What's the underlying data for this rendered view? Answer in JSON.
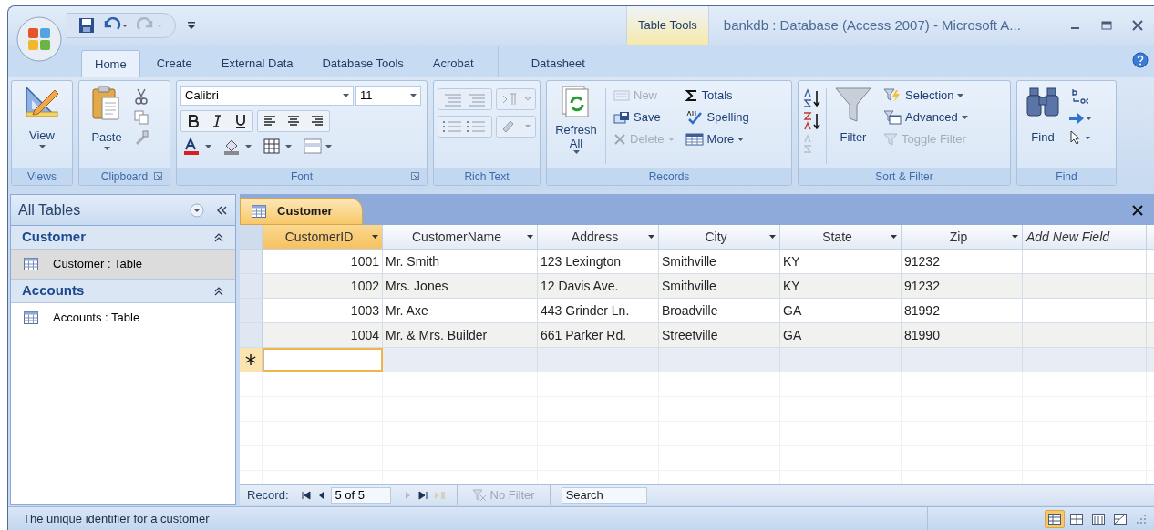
{
  "window": {
    "title": "bankdb : Database (Access 2007) - Microsoft A...",
    "context_group": "Table Tools"
  },
  "ribbon_tabs": [
    {
      "label": "Home",
      "selected": true
    },
    {
      "label": "Create",
      "selected": false
    },
    {
      "label": "External Data",
      "selected": false
    },
    {
      "label": "Database Tools",
      "selected": false
    },
    {
      "label": "Acrobat",
      "selected": false
    }
  ],
  "context_tabs": [
    {
      "label": "Datasheet",
      "selected": false
    }
  ],
  "ribbon": {
    "views": {
      "label": "Views",
      "view_button": "View"
    },
    "clipboard": {
      "label": "Clipboard",
      "paste_button": "Paste"
    },
    "font": {
      "label": "Font",
      "font_name": "Calibri",
      "font_size": "11"
    },
    "rich_text": {
      "label": "Rich Text"
    },
    "records": {
      "label": "Records",
      "refresh_button": "Refresh All",
      "buttons": [
        {
          "label": "New",
          "disabled": true
        },
        {
          "label": "Save",
          "disabled": false
        },
        {
          "label": "Delete",
          "disabled": true
        },
        {
          "label": "Totals",
          "disabled": false
        },
        {
          "label": "Spelling",
          "disabled": false
        },
        {
          "label": "More",
          "disabled": false
        }
      ]
    },
    "sort_filter": {
      "label": "Sort & Filter",
      "filter_button": "Filter",
      "buttons": [
        {
          "label": "Selection",
          "disabled": false
        },
        {
          "label": "Advanced",
          "disabled": false
        },
        {
          "label": "Toggle Filter",
          "disabled": true
        }
      ]
    },
    "find": {
      "label": "Find",
      "find_button": "Find"
    }
  },
  "nav_pane": {
    "title": "All Tables",
    "groups": [
      {
        "label": "Customer",
        "expanded": true,
        "items": [
          {
            "label": "Customer : Table",
            "selected": true
          }
        ]
      },
      {
        "label": "Accounts",
        "expanded": true,
        "items": [
          {
            "label": "Accounts : Table",
            "selected": false
          }
        ]
      }
    ]
  },
  "document_tab": {
    "label": "Customer"
  },
  "table": {
    "columns": [
      {
        "label": "CustomerID",
        "kind": "number",
        "selected": true
      },
      {
        "label": "CustomerName",
        "kind": "text",
        "selected": false
      },
      {
        "label": "Address",
        "kind": "text",
        "selected": false
      },
      {
        "label": "City",
        "kind": "text",
        "selected": false
      },
      {
        "label": "State",
        "kind": "text",
        "selected": false
      },
      {
        "label": "Zip",
        "kind": "text",
        "selected": false
      },
      {
        "label": "Add New Field",
        "kind": "new_field",
        "selected": false
      }
    ],
    "rows": [
      [
        "1001",
        "Mr. Smith",
        "123 Lexington",
        "Smithville",
        "KY",
        "91232"
      ],
      [
        "1002",
        "Mrs. Jones",
        "12 Davis Ave.",
        "Smithville",
        "KY",
        "91232"
      ],
      [
        "1003",
        "Mr. Axe",
        "443 Grinder Ln.",
        "Broadville",
        "GA",
        "81992"
      ],
      [
        "1004",
        "Mr. & Mrs. Builder",
        "661 Parker Rd.",
        "Streetville",
        "GA",
        "81990"
      ]
    ],
    "new_row": {
      "current": true
    }
  },
  "record_nav": {
    "label": "Record:",
    "position": "5 of 5",
    "filter": {
      "label": "No Filter",
      "disabled": true
    },
    "search": {
      "placeholder": "Search"
    }
  },
  "status_bar": {
    "text": "The unique identifier for a customer",
    "views": [
      {
        "selected": true
      },
      {
        "selected": false
      },
      {
        "selected": false
      },
      {
        "selected": false
      }
    ]
  }
}
